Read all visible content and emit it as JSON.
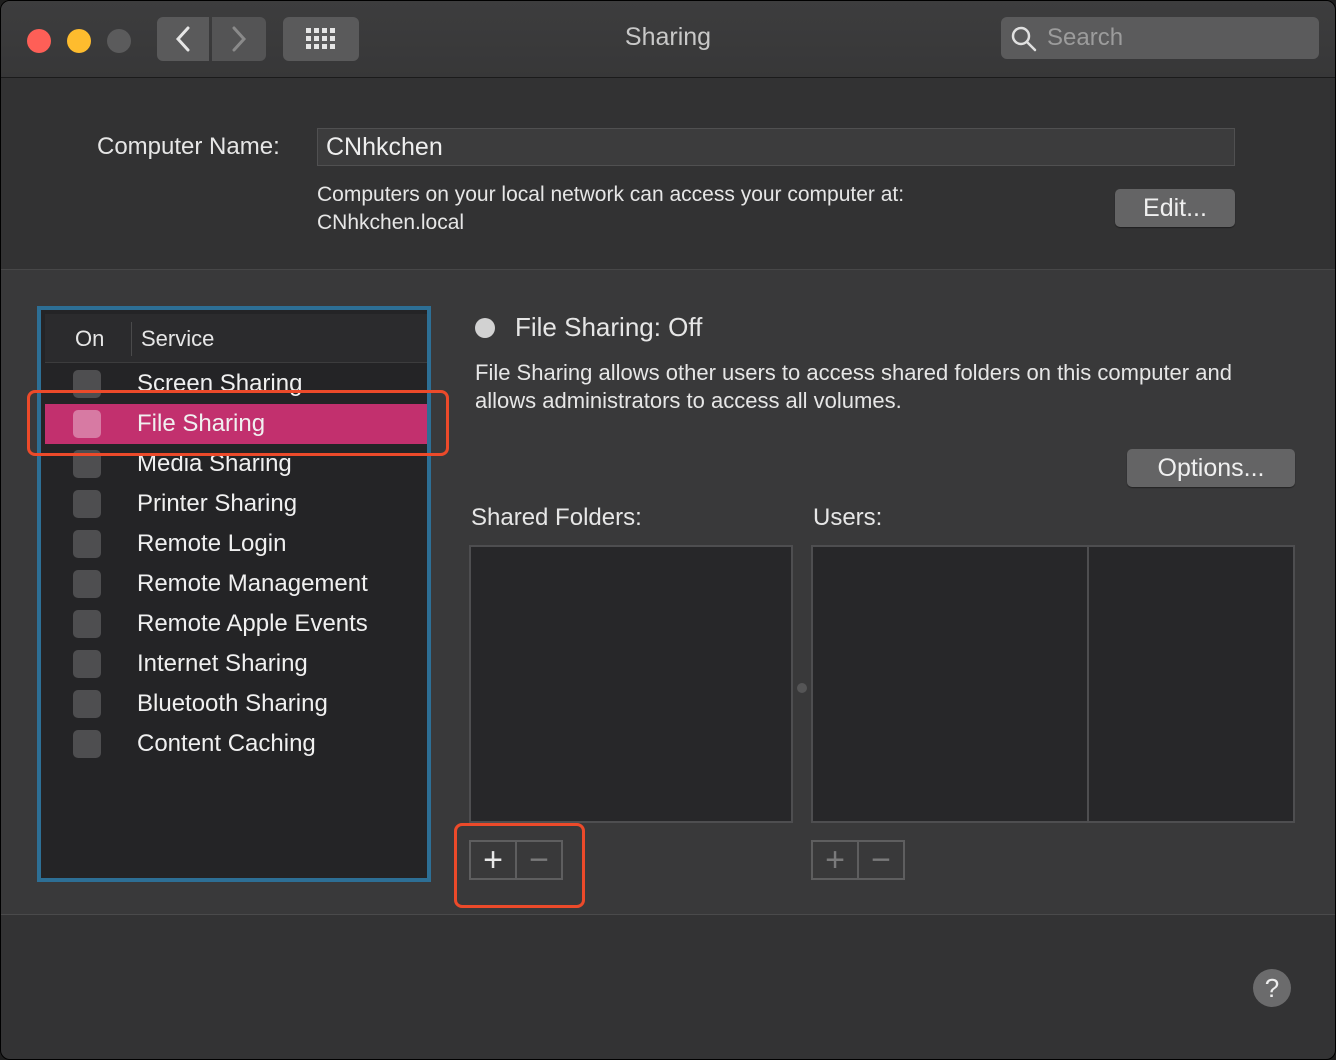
{
  "window": {
    "title": "Sharing"
  },
  "search": {
    "placeholder": "Search"
  },
  "computer_name": {
    "label": "Computer Name:",
    "value": "CNhkchen",
    "info_line1": "Computers on your local network can access your computer at:",
    "info_line2": "CNhkchen.local",
    "edit_label": "Edit..."
  },
  "services": {
    "header_on": "On",
    "header_service": "Service",
    "selected_index": 1,
    "items": [
      {
        "label": "Screen Sharing",
        "checked": false
      },
      {
        "label": "File Sharing",
        "checked": false
      },
      {
        "label": "Media Sharing",
        "checked": false
      },
      {
        "label": "Printer Sharing",
        "checked": false
      },
      {
        "label": "Remote Login",
        "checked": false
      },
      {
        "label": "Remote Management",
        "checked": false
      },
      {
        "label": "Remote Apple Events",
        "checked": false
      },
      {
        "label": "Internet Sharing",
        "checked": false
      },
      {
        "label": "Bluetooth Sharing",
        "checked": false
      },
      {
        "label": "Content Caching",
        "checked": false
      }
    ]
  },
  "detail": {
    "status": "File Sharing: Off",
    "description_line1": "File Sharing allows other users to access shared folders on this computer and",
    "description_line2": "allows administrators to access all volumes.",
    "options_label": "Options...",
    "shared_folders_label": "Shared Folders:",
    "users_label": "Users:",
    "plus_glyph": "+",
    "minus_glyph": "−"
  },
  "help_glyph": "?",
  "colors": {
    "selection": "#c2306e",
    "list_border": "#2d6f95",
    "annotation": "#ec4a2a"
  }
}
